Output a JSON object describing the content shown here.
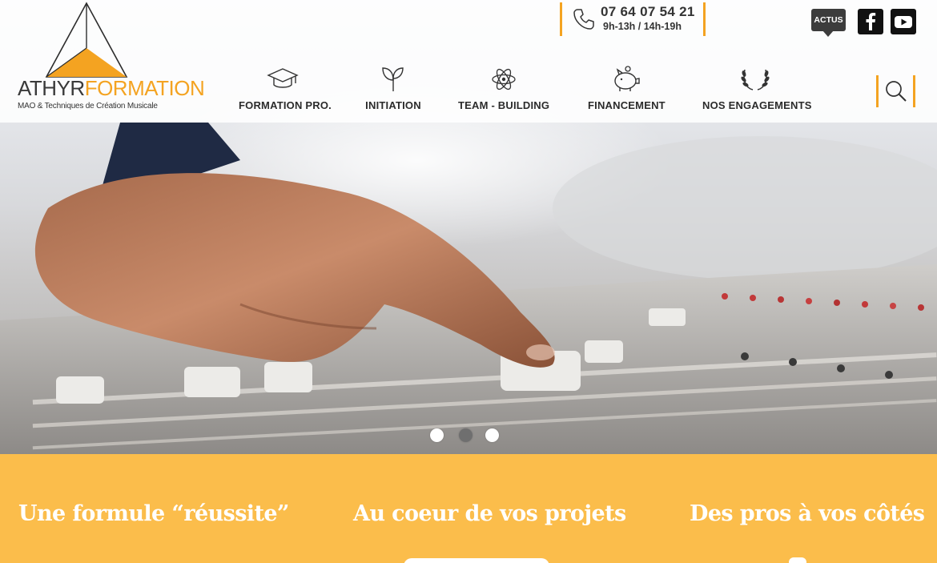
{
  "brand": {
    "name_part1": "ATHYR",
    "name_part2": "FORMATION",
    "tagline": "MAO & Techniques de Création Musicale",
    "accent_color": "#f4a321",
    "strip_color": "#fbbd4b"
  },
  "contact": {
    "phone": "07 64 07 54 21",
    "hours": "9h-13h / 14h-19h",
    "icon": "phone-icon"
  },
  "social": {
    "actus_label": "ACTUS",
    "facebook_icon": "facebook-icon",
    "youtube_icon": "youtube-icon"
  },
  "nav": {
    "items": [
      {
        "label": "FORMATION PRO.",
        "icon": "graduation-cap-icon"
      },
      {
        "label": "INITIATION",
        "icon": "sprout-icon"
      },
      {
        "label": "TEAM - BUILDING",
        "icon": "atom-icon"
      },
      {
        "label": "FINANCEMENT",
        "icon": "piggy-bank-icon"
      },
      {
        "label": "NOS ENGAGEMENTS",
        "icon": "laurel-wreath-icon"
      }
    ],
    "search_icon": "search-icon"
  },
  "slider": {
    "slide_count": 3,
    "active_index": 1
  },
  "features": [
    {
      "title": "Une formule “réussite”"
    },
    {
      "title": "Au coeur de vos projets"
    },
    {
      "title": "Des pros à vos côtés"
    }
  ]
}
